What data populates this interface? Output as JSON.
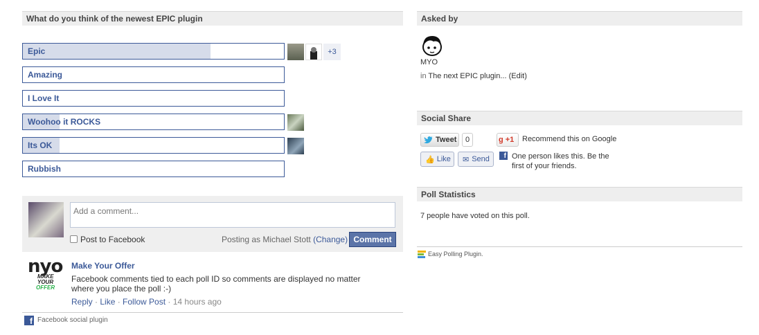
{
  "poll": {
    "question": "What do you think of the newest EPIC plugin",
    "options": [
      {
        "label": "Epic",
        "fraction": 0.72
      },
      {
        "label": "Amazing",
        "fraction": 0.0
      },
      {
        "label": "I Love It",
        "fraction": 0.0
      },
      {
        "label": "Woohoo it ROCKS",
        "fraction": 0.14
      },
      {
        "label": "Its OK",
        "fraction": 0.14
      },
      {
        "label": "Rubbish",
        "fraction": 0.0
      }
    ],
    "more_voters": "+3"
  },
  "comments": {
    "placeholder": "Add a comment...",
    "post_to_facebook": "Post to Facebook",
    "posting_as_prefix": "Posting as Michael Stott",
    "change_link": "(Change)",
    "comment_button": "Comment",
    "items": [
      {
        "author": "Make Your Offer",
        "text": "Facebook comments tied to each poll ID so comments are displayed no matter where you place the poll :-)",
        "reply": "Reply",
        "like": "Like",
        "follow": "Follow Post",
        "time": "14 hours ago"
      }
    ],
    "logo_text": "nyo",
    "logo_sub1": "MAKE",
    "logo_sub2": "YOUR",
    "logo_sub3": "OFFER",
    "social_plugin": "Facebook social plugin"
  },
  "asked_by": {
    "heading": "Asked by",
    "name": "MYO",
    "in_prefix": "in",
    "in_link": "The next EPIC plugin...",
    "edit": "(Edit)"
  },
  "social_share": {
    "heading": "Social Share",
    "tweet": "Tweet",
    "tweet_count": "0",
    "gplus": "+1",
    "gplus_text": "Recommend this on Google",
    "like": "Like",
    "send": "Send",
    "fb_text_line1": "One person likes this. Be the",
    "fb_text_line2": "first of your friends."
  },
  "poll_stats": {
    "heading": "Poll Statistics",
    "text": "7 people have voted on this poll."
  },
  "footer": {
    "credit": "Easy Polling Plugin."
  },
  "colors": {
    "fb_blue": "#3b5998",
    "bar_fill": "#d6dcea",
    "header_bg": "#eeeeee"
  }
}
